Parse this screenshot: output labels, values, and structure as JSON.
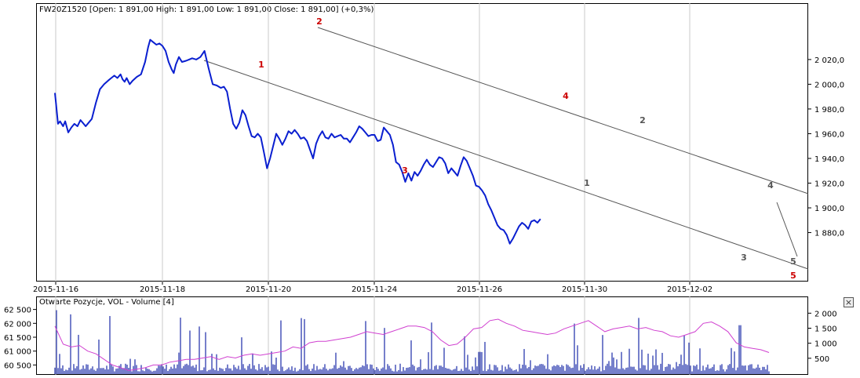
{
  "price_header": "FW20Z1520 [Open: 1 891,00  High: 1 891,00  Low: 1 891,00  Close: 1 891,00] (+0,3%)",
  "volume_header": "Otwarte Pozycje, VOL - Volume [4]",
  "close_button": "×",
  "colors": {
    "price_line": "#0a1fd0",
    "open_interest_line": "#d040d0",
    "volume_bars": "#1a2aa8",
    "channel_lines": "#555555",
    "wave_red": "#cc0000",
    "wave_gray": "#555555",
    "grid": "#c8c8c8"
  },
  "chart_data": [
    {
      "type": "line",
      "title": "FW20Z1520",
      "x_ticks": [
        "2015-11-16",
        "2015-11-18",
        "2015-11-20",
        "2015-11-24",
        "2015-11-26",
        "2015-11-30",
        "2015-12-02"
      ],
      "y_ticks": [
        "1 880,0",
        "1 900,0",
        "1 920,0",
        "1 940,0",
        "1 960,0",
        "1 980,0",
        "2 000,0",
        "2 020,0"
      ],
      "ylim": [
        1848,
        2058
      ],
      "series": [
        {
          "values_x_index": [
            0,
            0.1,
            0.3,
            0.5,
            0.8,
            1.0,
            1.3,
            1.6,
            1.9,
            2.2,
            2.5,
            2.8,
            3.0,
            3.3,
            3.6,
            4.0,
            4.4,
            4.8,
            5.2,
            5.5,
            5.8,
            6.1,
            6.4,
            6.6,
            6.8,
            7.0,
            7.3,
            7.6,
            8.0,
            8.4,
            8.8,
            9.1,
            9.3,
            9.6,
            9.9,
            10.2,
            10.5,
            10.8,
            11.1,
            11.4,
            11.6,
            11.8,
            12.1,
            12.4,
            12.8,
            13.1,
            13.4,
            13.8,
            14.2,
            14.6,
            15.0,
            15.4,
            15.8,
            16.2,
            16.5,
            16.8,
            17.1,
            17.4,
            17.7,
            18.0,
            18.3,
            18.6,
            18.9,
            19.2,
            19.5,
            19.8,
            20.1,
            20.4,
            20.7,
            21.0,
            21.3,
            21.6,
            21.9,
            22.2,
            22.5,
            22.8,
            23.1,
            23.4,
            23.7,
            24.0,
            24.3,
            24.6,
            24.9,
            25.2,
            25.5,
            25.8,
            26.1,
            26.4,
            26.7,
            27.0,
            27.3,
            27.6,
            27.9,
            28.2,
            28.5,
            28.8,
            29.1,
            29.4,
            29.7,
            30.0,
            30.3,
            30.6,
            30.9,
            31.2,
            31.5,
            31.8,
            32.1,
            32.4,
            32.7,
            33.0,
            33.3,
            33.6,
            33.9,
            34.2,
            34.5,
            34.8,
            35.1,
            35.4,
            35.7,
            36.0,
            36.3,
            36.6,
            36.9,
            37.2,
            37.5,
            37.8,
            38.1,
            38.4,
            38.7,
            39.0,
            39.3,
            39.6,
            39.9,
            40.2,
            40.5,
            40.8,
            41.1,
            41.4,
            41.7,
            42.0,
            42.3,
            42.6,
            42.9,
            43.2,
            43.5,
            43.8,
            44.1,
            44.4,
            44.7,
            45.0,
            45.3,
            45.6,
            45.9,
            46.2,
            46.5,
            46.8,
            47.1,
            47.4,
            47.7,
            48.0,
            48.3,
            48.6,
            48.9,
            49.2,
            49.5,
            49.8,
            50.1,
            50.4,
            50.7,
            51.0,
            51.3,
            51.6,
            51.9,
            52.2,
            52.5,
            52.8,
            53.1,
            53.4,
            53.7,
            54.0,
            54.3,
            54.6,
            54.9,
            55.2,
            55.5,
            55.8,
            56.1,
            56.4,
            56.7,
            57.0,
            57.3,
            57.6,
            57.9,
            58.2,
            58.5,
            58.8,
            59.1,
            59.4,
            59.7,
            60.0,
            60.3,
            60.6,
            60.9,
            61.2,
            61.5,
            61.8,
            62.1,
            62.4,
            62.7,
            63.0,
            63.3,
            63.6,
            63.9,
            64.2,
            64.5,
            64.8,
            65.1,
            65.4,
            65.7,
            66.0,
            66.3,
            66.6,
            66.9,
            67.2,
            67.5,
            67.8,
            68.1,
            68.4,
            68.7,
            69.0,
            69.3,
            69.6,
            69.9,
            70.2
          ],
          "values": [
            1993,
            1985,
            1968,
            1970,
            1966,
            1970,
            1961,
            1965,
            1968,
            1966,
            1971,
            1968,
            1966,
            1969,
            1972,
            1985,
            1996,
            2000,
            2003,
            2005,
            2007,
            2005,
            2008,
            2004,
            2002,
            2005,
            2000,
            2003,
            2006,
            2008,
            2018,
            2030,
            2036,
            2034,
            2032,
            2033,
            2031,
            2027,
            2018,
            2012,
            2009,
            2016,
            2022,
            2018,
            2019,
            2020,
            2021,
            2020,
            2022,
            2027,
            2013,
            2000,
            1999,
            1997,
            1998,
            1994,
            1980,
            1968,
            1964,
            1969,
            1979,
            1975,
            1966,
            1958,
            1957,
            1960,
            1957,
            1945,
            1932,
            1940,
            1950,
            1960,
            1956,
            1951,
            1956,
            1962,
            1960,
            1963,
            1960,
            1956,
            1957,
            1954,
            1947,
            1940,
            1952,
            1958,
            1962,
            1957,
            1956,
            1960,
            1957,
            1958,
            1959,
            1956,
            1956,
            1953,
            1957,
            1961,
            1966,
            1964,
            1961,
            1958,
            1959,
            1959,
            1954,
            1955,
            1965,
            1962,
            1959,
            1951,
            1937,
            1935,
            1929,
            1921,
            1928,
            1922,
            1929,
            1926,
            1930,
            1935,
            1939,
            1935,
            1933,
            1937,
            1941,
            1940,
            1936,
            1928,
            1932,
            1929,
            1926,
            1934,
            1941,
            1938,
            1932,
            1926,
            1918,
            1917,
            1914,
            1910,
            1903,
            1898,
            1892,
            1886,
            1883,
            1882,
            1878,
            1871,
            1875,
            1880,
            1885,
            1888,
            1886,
            1883,
            1889,
            1890,
            1888,
            1891,
            1890,
            1891,
            1890,
            1891,
            1891,
            1891,
            1891,
            1891,
            1891,
            1891,
            1891,
            1891,
            1891,
            1891,
            1891,
            1891,
            1891,
            1891,
            1891,
            1891,
            1891,
            1891,
            1891,
            1891,
            1891,
            1891,
            1891,
            1891,
            1891,
            1891,
            1891,
            1891,
            1891,
            1891,
            1891,
            1891,
            1891,
            1891,
            1891,
            1891,
            1891,
            1891,
            1891,
            1891,
            1891,
            1891,
            1891,
            1891,
            1891,
            1891,
            1891,
            1891,
            1891,
            1891,
            1891,
            1891,
            1891,
            1891,
            1891,
            1891,
            1891,
            1891,
            1891,
            1891,
            1891,
            1891,
            1891,
            1891,
            1891,
            1891,
            1891,
            1891,
            1891,
            1891,
            1891,
            1891,
            1891,
            1891,
            1891,
            1891,
            1891,
            1891
          ]
        }
      ],
      "wave_labels_red": [
        {
          "label": "1",
          "x": 11.6,
          "y": 2001
        },
        {
          "label": "2",
          "x": 15.0,
          "y": 2038
        },
        {
          "label": "3",
          "x": 20.4,
          "y": 1920
        },
        {
          "label": "4",
          "x": 28.7,
          "y": 1972
        },
        {
          "label": "5",
          "x": 40.9,
          "y": 1852
        }
      ],
      "wave_labels_gray": [
        {
          "label": "1",
          "x": 29.9,
          "y": 1912
        },
        {
          "label": "2",
          "x": 32.3,
          "y": 1958
        },
        {
          "label": "3",
          "x": 38.7,
          "y": 1861
        },
        {
          "label": "4",
          "x": 39.9,
          "y": 1911
        },
        {
          "label": "5",
          "x": 40.9,
          "y": 1861
        }
      ]
    },
    {
      "type": "bar",
      "title": "Otwarte Pozycje, VOL - Volume [4]",
      "left_ticks": [
        "60 500",
        "61 000",
        "61 500",
        "62 000",
        "62 500"
      ],
      "right_ticks": [
        "500",
        "1 000",
        "1 500",
        "2 000"
      ],
      "open_interest_range": [
        60200,
        62800
      ],
      "volume_range": [
        0,
        2400
      ],
      "open_interest": [
        61900,
        61250,
        61150,
        61200,
        61000,
        60900,
        60700,
        60500,
        60400,
        60300,
        60350,
        60400,
        60500,
        60500,
        60600,
        60650,
        60700,
        60700,
        60750,
        60800,
        60700,
        60800,
        60750,
        60850,
        60900,
        60850,
        60900,
        60950,
        61000,
        61150,
        61100,
        61300,
        61350,
        61350,
        61400,
        61450,
        61500,
        61600,
        61700,
        61650,
        61600,
        61700,
        61800,
        61900,
        61900,
        61850,
        61700,
        61400,
        61200,
        61250,
        61500,
        61800,
        61850,
        62100,
        62150,
        62000,
        61900,
        61750,
        61700,
        61650,
        61600,
        61650,
        61800,
        61900,
        62000,
        62100,
        61900,
        61700,
        61800,
        61850,
        61900,
        61800,
        61850,
        61750,
        61700,
        61550,
        61500,
        61600,
        61700,
        62000,
        62050,
        61900,
        61700,
        61300,
        61150,
        61100,
        61050,
        60950
      ]
    }
  ]
}
